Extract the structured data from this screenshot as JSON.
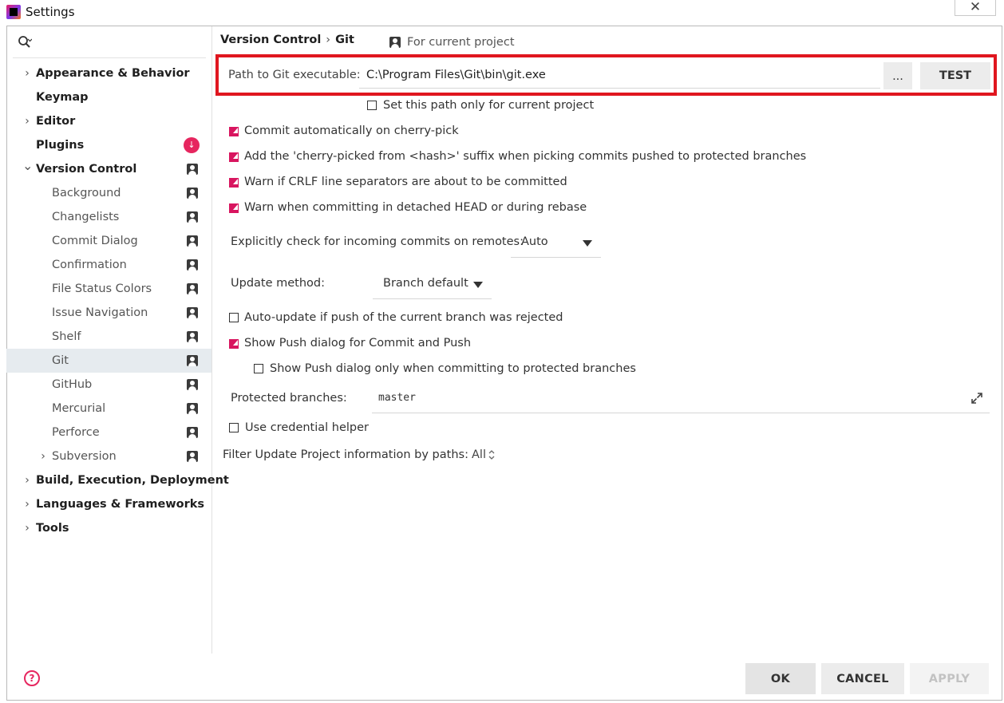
{
  "window": {
    "title": "Settings",
    "close_glyph": "✕"
  },
  "search": {
    "icon": "search-icon"
  },
  "sidebar": {
    "items": [
      {
        "label": "Appearance & Behavior",
        "level": 0,
        "expandable": true
      },
      {
        "label": "Keymap",
        "level": 0
      },
      {
        "label": "Editor",
        "level": 0,
        "expandable": true
      },
      {
        "label": "Plugins",
        "level": 0,
        "badge": "↓"
      },
      {
        "label": "Version Control",
        "level": 0,
        "expanded": true,
        "project_icon": true
      },
      {
        "label": "Background",
        "level": 1,
        "project_icon": true
      },
      {
        "label": "Changelists",
        "level": 1,
        "project_icon": true
      },
      {
        "label": "Commit Dialog",
        "level": 1,
        "project_icon": true
      },
      {
        "label": "Confirmation",
        "level": 1,
        "project_icon": true
      },
      {
        "label": "File Status Colors",
        "level": 1,
        "project_icon": true
      },
      {
        "label": "Issue Navigation",
        "level": 1,
        "project_icon": true
      },
      {
        "label": "Shelf",
        "level": 1,
        "project_icon": true
      },
      {
        "label": "Git",
        "level": 1,
        "project_icon": true,
        "selected": true
      },
      {
        "label": "GitHub",
        "level": 1,
        "project_icon": true
      },
      {
        "label": "Mercurial",
        "level": 1,
        "project_icon": true
      },
      {
        "label": "Perforce",
        "level": 1,
        "project_icon": true
      },
      {
        "label": "Subversion",
        "level": 1,
        "project_icon": true,
        "expandable": true
      },
      {
        "label": "Build, Execution, Deployment",
        "level": 0,
        "expandable": true
      },
      {
        "label": "Languages & Frameworks",
        "level": 0,
        "expandable": true
      },
      {
        "label": "Tools",
        "level": 0,
        "expandable": true
      }
    ]
  },
  "header": {
    "breadcrumb_parent": "Version Control",
    "breadcrumb_sep": "›",
    "breadcrumb_current": "Git",
    "scope_label": "For current project"
  },
  "git_path": {
    "label": "Path to Git executable:",
    "value": "C:\\Program Files\\Git\\bin\\git.exe",
    "browse_label": "...",
    "test_label": "TEST",
    "only_current_label": "Set this path only for current project",
    "only_current_checked": false
  },
  "options": {
    "commit_cherry_pick": {
      "label": "Commit automatically on cherry-pick",
      "checked": true
    },
    "cherry_picked_suffix": {
      "label": "Add the 'cherry-picked from <hash>' suffix when picking commits pushed to protected branches",
      "checked": true
    },
    "warn_crlf": {
      "label": "Warn if CRLF line separators are about to be committed",
      "checked": true
    },
    "warn_detached": {
      "label": "Warn when committing in detached HEAD or during rebase",
      "checked": true
    },
    "incoming_label": "Explicitly check for incoming commits on remotes:",
    "incoming_value": "Auto",
    "update_method_label": "Update method:",
    "update_method_value": "Branch default",
    "auto_update": {
      "label": "Auto-update if push of the current branch was rejected",
      "checked": false
    },
    "show_push": {
      "label": "Show Push dialog for Commit and Push",
      "checked": true
    },
    "show_push_protected": {
      "label": "Show Push dialog only when committing to protected branches",
      "checked": false
    },
    "protected_label": "Protected branches:",
    "protected_value": "master",
    "credential_helper": {
      "label": "Use credential helper",
      "checked": false
    },
    "filter_label": "Filter Update Project information by paths:",
    "filter_value": "All"
  },
  "footer": {
    "help_glyph": "?",
    "ok_label": "OK",
    "cancel_label": "CANCEL",
    "apply_label": "APPLY"
  },
  "colors": {
    "accent": "#d8155f",
    "highlight_box": "#e0161f",
    "selection": "#e6ebef"
  }
}
